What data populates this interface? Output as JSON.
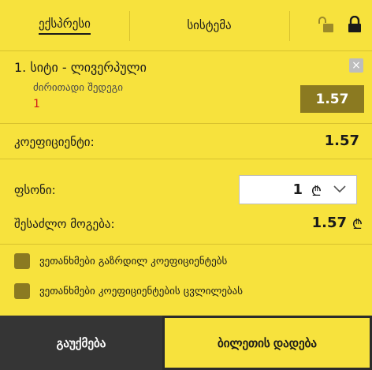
{
  "tabs": [
    {
      "label": "ექსპრესი",
      "active": true
    },
    {
      "label": "სისტემა",
      "active": false
    }
  ],
  "event": {
    "title": "1. სიტი - ლივერპული",
    "market": "ძირითადი შედეგი",
    "outcome": "1",
    "odd": "1.57",
    "close_symbol": "×"
  },
  "coefficient": {
    "label": "კოეფიციენტი:",
    "value": "1.57"
  },
  "stake": {
    "label": "ფსონი:",
    "value": "1",
    "currency": "₾"
  },
  "possible_win": {
    "label": "შესაძლო მოგება:",
    "value": "1.57",
    "currency": "₾"
  },
  "options": [
    "ვეთანხმები გაზრდილ კოეფიციენტებს",
    "ვეთანხმები კოეფიციენტების ცვლილებას"
  ],
  "buttons": {
    "cancel": "გაუქმება",
    "place_bet": "ბილეთის დადება"
  },
  "icons": [
    "lock-open-icon",
    "lock-icon",
    "close-icon",
    "chevron-down-icon"
  ],
  "colors": {
    "background": "#f7e23d",
    "accent": "#8b7a21",
    "dark": "#353535",
    "outcome": "#d21919"
  }
}
